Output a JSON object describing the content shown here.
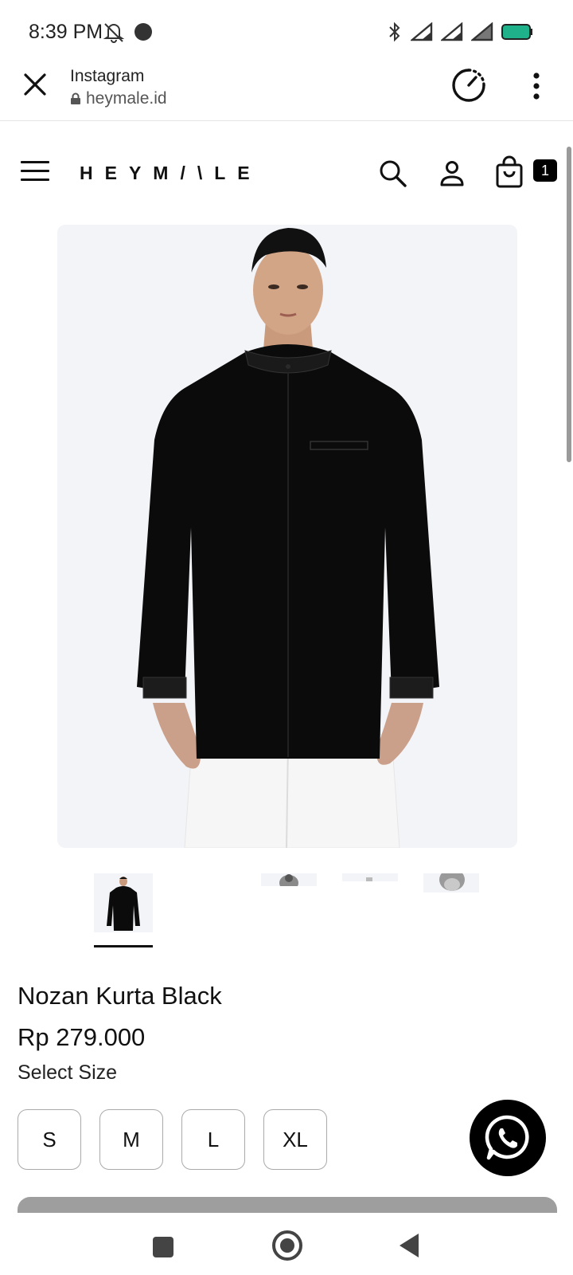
{
  "status_bar": {
    "time": "8:39 PM",
    "icons": [
      "mute-icon",
      "dot-icon",
      "bluetooth-icon",
      "signal-icon",
      "signal-icon",
      "signal-icon",
      "battery-icon"
    ],
    "battery_color": "#1fb28a"
  },
  "tab_header": {
    "title": "Instagram",
    "url": "heymale.id",
    "icons": [
      "close-icon",
      "lock-icon",
      "speedometer-icon",
      "more-vertical-icon"
    ]
  },
  "site_header": {
    "logo": "HEYM/\\LE",
    "cart_count": "1",
    "icons": [
      "hamburger-icon",
      "search-icon",
      "account-icon",
      "cart-icon"
    ]
  },
  "product": {
    "name": "Nozan Kurta Black",
    "price": "Rp 279.000",
    "select_size_label": "Select Size",
    "sizes": [
      "S",
      "M",
      "L",
      "XL"
    ],
    "thumbnail_count": 4
  },
  "colors": {
    "accent": "#000000",
    "image_background": "#f3f4f8"
  },
  "nav_bar": {
    "icons": [
      "recents-icon",
      "home-icon",
      "back-icon"
    ]
  }
}
